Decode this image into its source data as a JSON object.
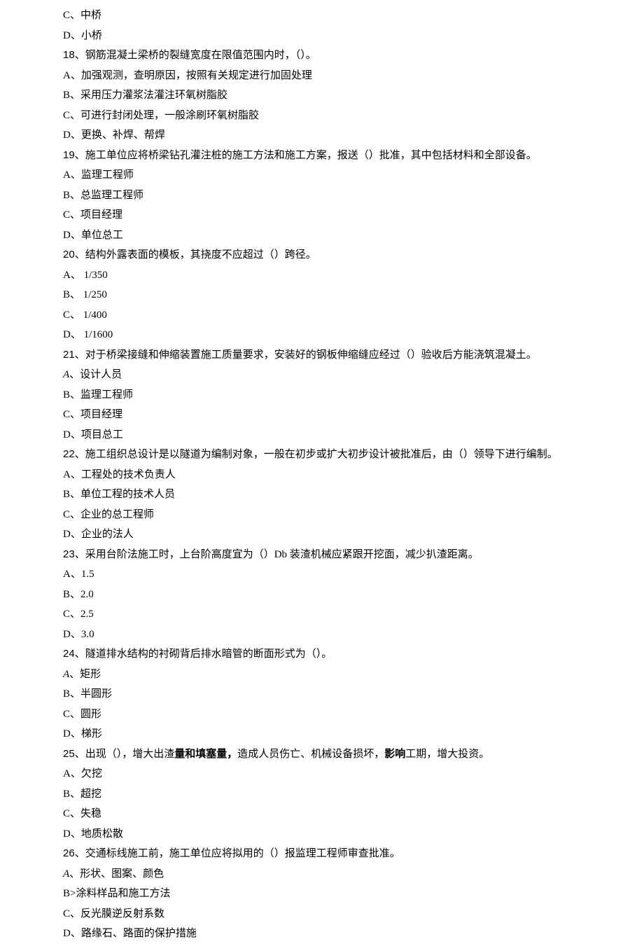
{
  "lines": [
    {
      "text": "C、中桥"
    },
    {
      "text": "D、小桥"
    },
    {
      "num": "18",
      "text": "、钢筋混凝土梁桥的裂缝宽度在限值范围内时，（）。"
    },
    {
      "text": "A、加强观测，查明原因，按照有关规定进行加固处理"
    },
    {
      "text": "B、采用压力灌浆法灌注环氧树脂胶"
    },
    {
      "text": "C、可进行封闭处理，一般涂刷环氧树脂胶"
    },
    {
      "text": "D、更换、补焊、帮焊"
    },
    {
      "num": "19",
      "text": "、施工单位应将桥梁钻孔灌注桩的施工方法和施工方案，报送（）批准，其中包括材料和全部设备。"
    },
    {
      "text": "A、监理工程师"
    },
    {
      "text": "B、总监理工程师"
    },
    {
      "text": "C、项目经理"
    },
    {
      "text": "D、单位总工"
    },
    {
      "num": "20",
      "text": "、结构外露表面的模板，其挠度不应超过（）跨径。"
    },
    {
      "text": "A、 1/350"
    },
    {
      "text": "B、 1/250"
    },
    {
      "text": "C、 1/400"
    },
    {
      "text": "D、 1/1600"
    },
    {
      "num": "21",
      "text": "、对于桥梁接缝和伸缩装置施工质量要求，安装好的钢板伸缩缝应经过（）验收后方能浇筑混凝土。"
    },
    {
      "italicA": true,
      "text": "、设计人员"
    },
    {
      "text": "B、监理工程师"
    },
    {
      "text": "C、项目经理"
    },
    {
      "text": "D、项目总工"
    },
    {
      "num": "22",
      "text": "、施工组织总设计是以隧道为编制对象，一般在初步或扩大初步设计被批准后，由（）领导下进行编制。"
    },
    {
      "text": "A、工程处的技术负责人"
    },
    {
      "text": "B、单位工程的技术人员"
    },
    {
      "text": "C、企业的总工程师"
    },
    {
      "text": "D、企业的法人"
    },
    {
      "num": "23",
      "text": "、采用台阶法施工时，上台阶高度宜为（）Db 装渣机械应紧跟开挖面，减少扒渣距离。"
    },
    {
      "text": "A、1.5"
    },
    {
      "text": "B、2.0"
    },
    {
      "text": "C、2.5"
    },
    {
      "text": "D、3.0"
    },
    {
      "num": "24",
      "text": "、隧道排水结构的衬砌背后排水暗管的断面形式为（）。"
    },
    {
      "italicA": true,
      "text": "、矩形"
    },
    {
      "text": "B、半圆形"
    },
    {
      "text": "C、圆形"
    },
    {
      "text": "D、梯形"
    },
    {
      "num": "25",
      "text_parts": [
        {
          "t": "、出现（），增大出渣",
          "b": false
        },
        {
          "t": "量和填塞量，",
          "b": true
        },
        {
          "t": "造成人员伤亡、机械设备损坏，",
          "b": false
        },
        {
          "t": "影响",
          "b": true
        },
        {
          "t": "工期，增大投资。",
          "b": false
        }
      ]
    },
    {
      "text": "A、欠挖"
    },
    {
      "text": "B、超挖"
    },
    {
      "text": "C、失稳"
    },
    {
      "text": "D、地质松散"
    },
    {
      "num": "26",
      "text": "、交通标线施工前，施工单位应将拟用的（）报监理工程师审查批准。"
    },
    {
      "italicA": true,
      "text": "、形状、图案、颜色"
    },
    {
      "text": "B>涂料样品和施工方法"
    },
    {
      "text": "C、反光膜逆反射系数"
    },
    {
      "text": "D、路缘石、路面的保护措施"
    }
  ]
}
